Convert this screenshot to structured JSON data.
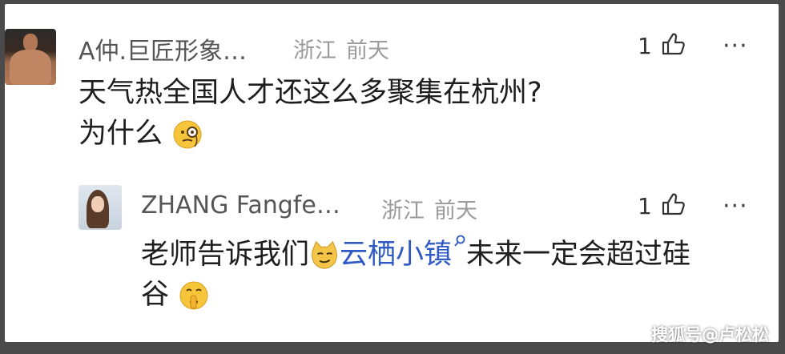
{
  "comments": [
    {
      "user_name": "A仲.巨匠形象…",
      "location": "浙江",
      "time": "前天",
      "like_count": "1",
      "text_line1": "天气热全国人才还这么多聚集在杭州?",
      "text_line2": "为什么",
      "emoji_name": "monocle-face-emoji"
    },
    {
      "user_name": "ZHANG Fangfe…",
      "location": "浙江",
      "time": "前天",
      "like_count": "1",
      "text_prefix": "老师告诉我们",
      "link_text": "云栖小镇",
      "text_suffix": "未来一定会超过硅",
      "text_line2": "谷",
      "emoji_names": [
        "smirking-cat-emoji",
        "shushing-face-emoji"
      ]
    }
  ],
  "more_label": "···",
  "watermark": "搜狐号@卢松松"
}
